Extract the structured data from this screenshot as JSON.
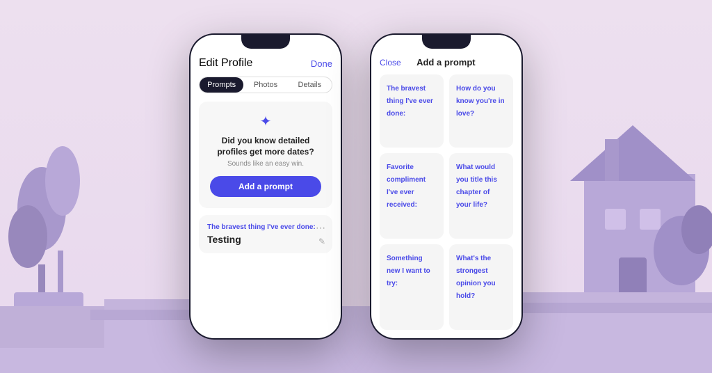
{
  "background": {
    "color": "#ede0ef"
  },
  "phone1": {
    "header": {
      "title": "Edit Profile",
      "done_label": "Done"
    },
    "tabs": [
      {
        "label": "Prompts",
        "active": true
      },
      {
        "label": "Photos",
        "active": false
      },
      {
        "label": "Details",
        "active": false
      }
    ],
    "prompt_card": {
      "icon": "✦",
      "title": "Did you know detailed profiles get more dates?",
      "subtitle": "Sounds like an easy win.",
      "button_label": "Add a prompt"
    },
    "existing_prompt": {
      "label": "The bravest thing I've ever done:",
      "text": "Testing"
    }
  },
  "phone2": {
    "header": {
      "close_label": "Close",
      "title": "Add a prompt"
    },
    "prompts": [
      {
        "text": "The bravest thing I've ever done:"
      },
      {
        "text": "How do you know you're in love?"
      },
      {
        "text": "Favorite compliment I've ever received:"
      },
      {
        "text": "What would you title this chapter of your life?"
      },
      {
        "text": "Something new I want to try:"
      },
      {
        "text": "What's the strongest opinion you hold?"
      }
    ]
  }
}
